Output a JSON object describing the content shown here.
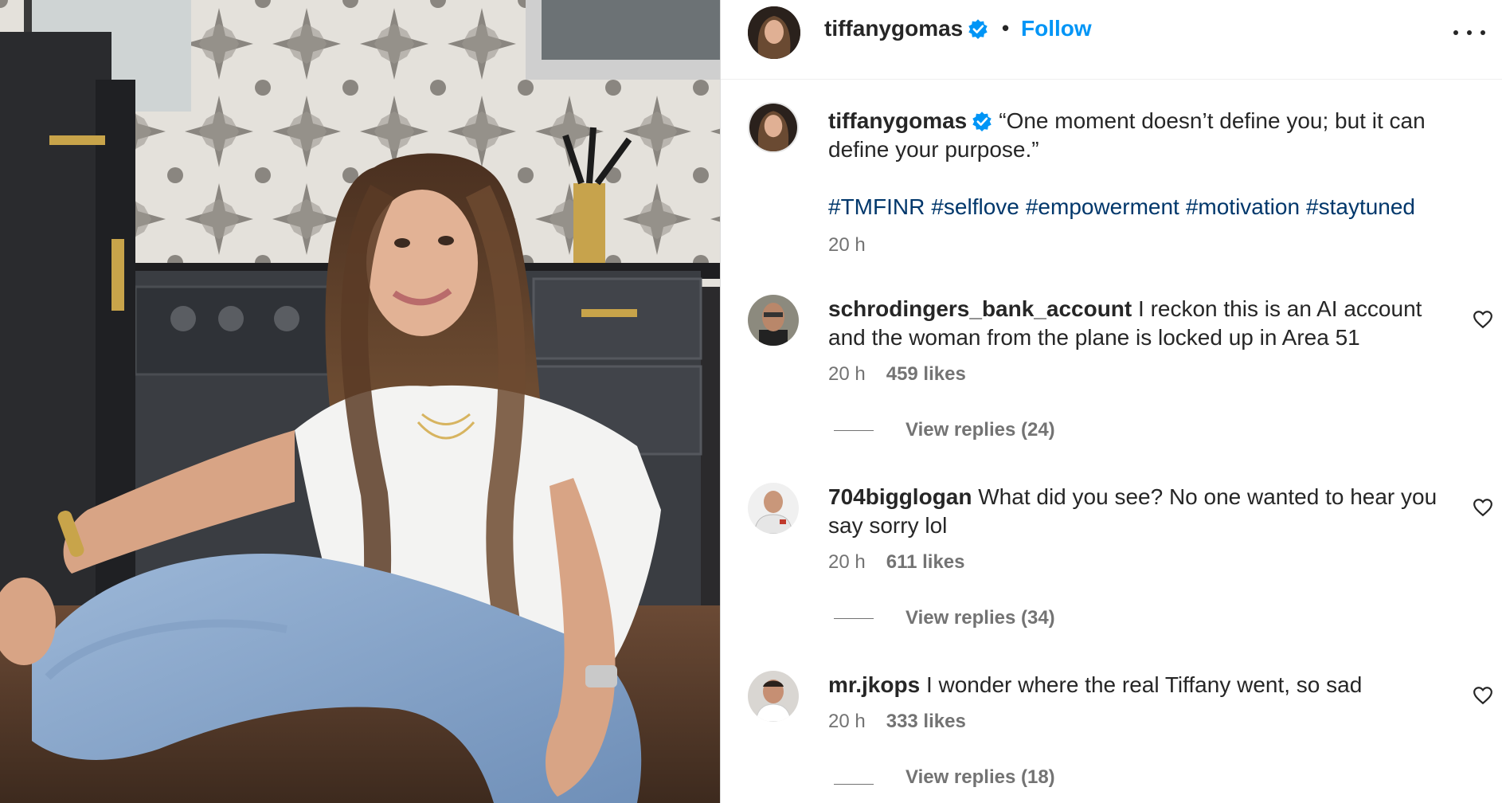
{
  "header": {
    "username": "tiffanygomas",
    "separator": "•",
    "follow_label": "Follow",
    "more_icon": "more-horizontal-icon"
  },
  "caption": {
    "username": "tiffanygomas",
    "text": "“One moment doesn’t define you; but it can define your purpose.”",
    "hashtags": [
      "#TMFINR",
      "#selflove",
      "#empowerment",
      "#motivation",
      "#staytuned"
    ],
    "time": "20 h"
  },
  "comments": [
    {
      "username": "schrodingers_bank_account",
      "text": "I reckon this is an AI account and the woman from the plane is locked up in Area 51",
      "time": "20 h",
      "likes": "459 likes",
      "replies": "View replies (24)"
    },
    {
      "username": "704bigglogan",
      "text": "What did you see? No one wanted to hear you say sorry lol",
      "time": "20 h",
      "likes": "611 likes",
      "replies": "View replies (34)"
    },
    {
      "username": "mr.jkops",
      "text": "I wonder where the real Tiffany went, so sad",
      "time": "20 h",
      "likes": "333 likes",
      "replies": "View replies (18)"
    }
  ],
  "colors": {
    "link_blue": "#0095f6",
    "hashtag_blue": "#00376b",
    "verified_blue": "#0095f6",
    "meta_gray": "#737373"
  }
}
